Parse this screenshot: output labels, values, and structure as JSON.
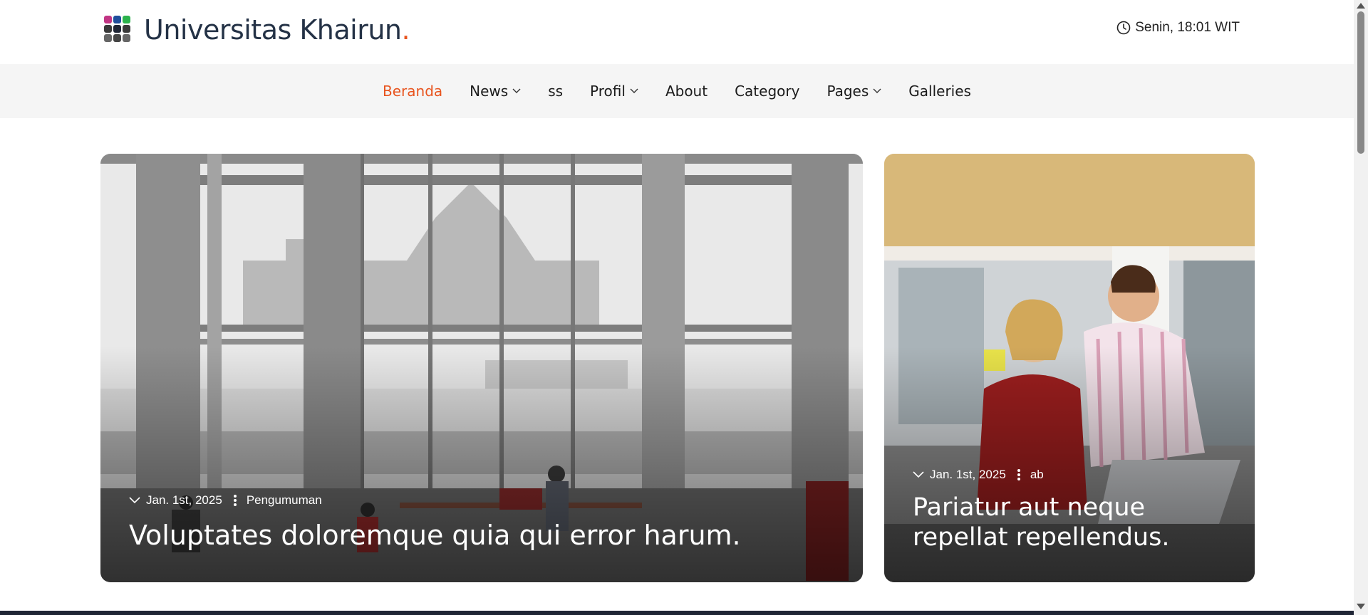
{
  "header": {
    "site_title": "Universitas Khairun",
    "title_dot": ".",
    "datetime": "Senin, 18:01 WIT",
    "logo_icons": [
      "instagram-icon",
      "facebook-icon",
      "whatsapp-icon",
      "instagram-icon",
      "facebook-icon",
      "whatsapp-icon",
      "instagram-icon",
      "facebook-icon",
      "whatsapp-icon"
    ]
  },
  "nav": {
    "items": [
      {
        "label": "Beranda",
        "active": true,
        "dropdown": false
      },
      {
        "label": "News",
        "active": false,
        "dropdown": true
      },
      {
        "label": "ss",
        "active": false,
        "dropdown": false
      },
      {
        "label": "Profil",
        "active": false,
        "dropdown": true
      },
      {
        "label": "About",
        "active": false,
        "dropdown": false
      },
      {
        "label": "Category",
        "active": false,
        "dropdown": false
      },
      {
        "label": "Pages",
        "active": false,
        "dropdown": true
      },
      {
        "label": "Galleries",
        "active": false,
        "dropdown": false
      }
    ]
  },
  "featured": [
    {
      "date": "Jan. 1st, 2025",
      "category": "Pengumuman",
      "title": "Voluptates doloremque quia qui error harum."
    },
    {
      "date": "Jan. 1st, 2025",
      "category": "ab",
      "title": "Pariatur aut neque repellat repellendus."
    }
  ],
  "colors": {
    "accent": "#e8541e",
    "title": "#243246",
    "nav_bg": "#f5f5f5"
  }
}
